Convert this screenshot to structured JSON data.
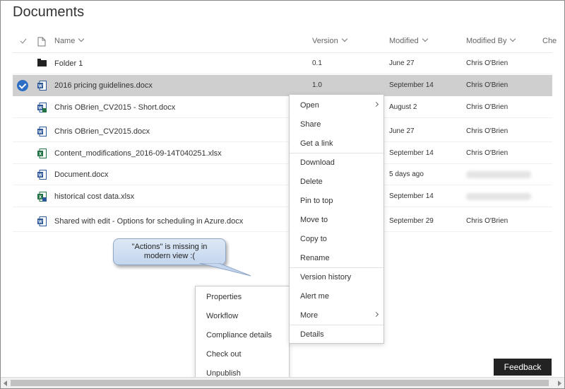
{
  "page": {
    "title": "Documents"
  },
  "columns": {
    "name": "Name",
    "version": "Version",
    "modified": "Modified",
    "modified_by": "Modified By",
    "checked_out": "Che"
  },
  "rows": [
    {
      "name": "Folder 1",
      "version": "0.1",
      "modified": "June 27",
      "modified_by": "Chris O'Brien",
      "icon": "folder-icon"
    },
    {
      "name": "2016 pricing guidelines.docx",
      "version": "1.0",
      "modified": "September 14",
      "modified_by": "Chris O'Brien",
      "icon": "word-doc-icon",
      "selected": true
    },
    {
      "name": "Chris OBrien_CV2015 - Short.docx",
      "version": "",
      "modified": "August 2",
      "modified_by": "Chris O'Brien",
      "icon": "word-doc-edit-icon"
    },
    {
      "name": "Chris OBrien_CV2015.docx",
      "version": "",
      "modified": "June 27",
      "modified_by": "Chris O'Brien",
      "icon": "word-doc-icon"
    },
    {
      "name": "Content_modifications_2016-09-14T040251.xlsx",
      "version": "",
      "modified": "September 14",
      "modified_by": "Chris O'Brien",
      "icon": "excel-doc-icon"
    },
    {
      "name": "Document.docx",
      "version": "",
      "modified": "5 days ago",
      "modified_by": "",
      "icon": "word-doc-icon"
    },
    {
      "name": "historical cost data.xlsx",
      "version": "",
      "modified": "September 14",
      "modified_by": "",
      "icon": "excel-doc-edit-icon"
    },
    {
      "name": "Shared with edit - Options for scheduling in Azure.docx",
      "version": "",
      "modified": "September 29",
      "modified_by": "Chris O'Brien",
      "icon": "word-doc-icon"
    }
  ],
  "context_menu": {
    "items": [
      "Open",
      "Share",
      "Get a link",
      "Download",
      "Delete",
      "Pin to top",
      "Move to",
      "Copy to",
      "Rename",
      "Version history",
      "Alert me",
      "More",
      "Details"
    ]
  },
  "more_menu": {
    "items": [
      "Properties",
      "Workflow",
      "Compliance details",
      "Check out",
      "Unpublish"
    ]
  },
  "callout": {
    "line1": "\"Actions\" is missing in",
    "line2": "modern view :("
  },
  "feedback": {
    "label": "Feedback"
  },
  "colors": {
    "accent": "#2b6ec4",
    "word": "#2b579a",
    "excel": "#217346",
    "selected_row": "#cfcfcf"
  }
}
